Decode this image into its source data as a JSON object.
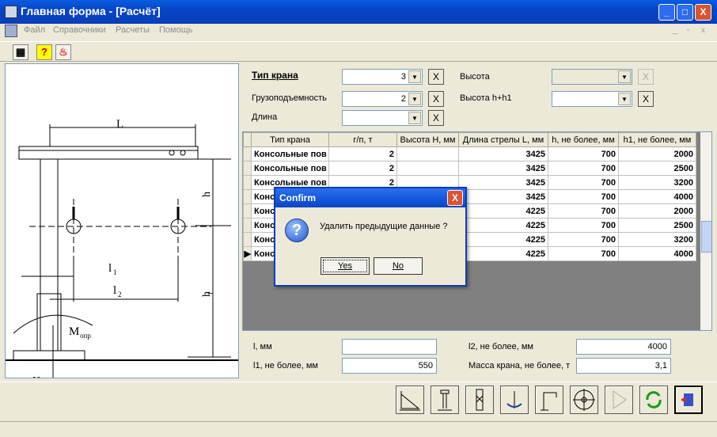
{
  "window": {
    "title": "Главная форма - [Расчёт]",
    "min": "_",
    "max": "□",
    "close": "X"
  },
  "menu": [
    "Файл",
    "Справочники",
    "Расчеты",
    "Помощь"
  ],
  "mdi": {
    "min": "_",
    "restore": "▫",
    "close": "x"
  },
  "toolbar": {
    "calc": "▦",
    "help": "?",
    "info": "♨"
  },
  "filters": {
    "crane_type": {
      "label": "Тип крана",
      "value": "3"
    },
    "capacity": {
      "label": "Грузоподъемность",
      "value": "2"
    },
    "length": {
      "label": "Длина",
      "value": ""
    },
    "height": {
      "label": "Высота",
      "value": ""
    },
    "height_h_h1": {
      "label": "Высота h+h1",
      "value": ""
    },
    "clear": "X"
  },
  "grid": {
    "columns": [
      "Тип крана",
      "г/п, т",
      "Высота H, мм",
      "Длина стрелы L, мм",
      "h, не более, мм",
      "h1, не более, мм"
    ],
    "rows": [
      {
        "type": "Консольные пов",
        "gp": "2",
        "h": "",
        "l": "3425",
        "hh": "700",
        "h1": "2000"
      },
      {
        "type": "Консольные пов",
        "gp": "2",
        "h": "",
        "l": "3425",
        "hh": "700",
        "h1": "2500"
      },
      {
        "type": "Консольные пов",
        "gp": "2",
        "h": "",
        "l": "3425",
        "hh": "700",
        "h1": "3200"
      },
      {
        "type": "Конс",
        "gp": "",
        "h": "",
        "l": "3425",
        "hh": "700",
        "h1": "4000"
      },
      {
        "type": "Конс",
        "gp": "",
        "h": "",
        "l": "4225",
        "hh": "700",
        "h1": "2000"
      },
      {
        "type": "Конс",
        "gp": "",
        "h": "",
        "l": "4225",
        "hh": "700",
        "h1": "2500"
      },
      {
        "type": "Конс",
        "gp": "",
        "h": "",
        "l": "4225",
        "hh": "700",
        "h1": "3200"
      },
      {
        "type": "Конс",
        "gp": "",
        "h": "",
        "l": "4225",
        "hh": "700",
        "h1": "4000"
      }
    ],
    "current_marker": "▶"
  },
  "params": {
    "l": {
      "label": "l, мм",
      "value": ""
    },
    "l1": {
      "label": "l1, не более, мм",
      "value": "550"
    },
    "l2": {
      "label": "l2, не более, мм",
      "value": "4000"
    },
    "mass": {
      "label": "Масса крана, не более, т",
      "value": "3,1"
    }
  },
  "diagram": {
    "L": "L",
    "h": "h",
    "h1": "h",
    "h1_sub": "1",
    "l1": "l",
    "l1_sub": "1",
    "l2": "l",
    "l2_sub": "2",
    "M": "M",
    "M_sub": "опр",
    "H": "H"
  },
  "dialog": {
    "title": "Confirm",
    "close": "X",
    "icon": "?",
    "message": "Удалить предыдущие данные ?",
    "yes": "Yes",
    "no": "No"
  }
}
